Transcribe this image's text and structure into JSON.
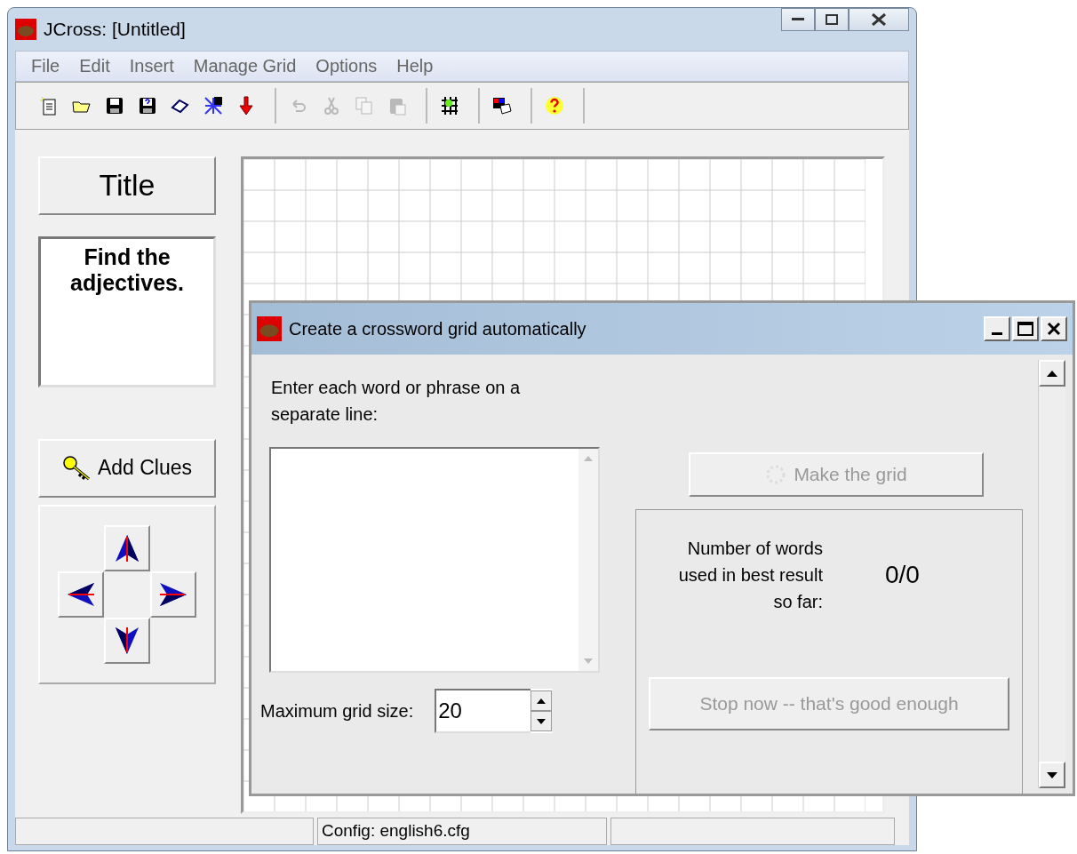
{
  "window": {
    "title": "JCross: [Untitled]"
  },
  "menu": [
    "File",
    "Edit",
    "Insert",
    "Manage Grid",
    "Options",
    "Help"
  ],
  "toolbar": [
    [
      {
        "disabled": false
      },
      {
        "disabled": false
      },
      {
        "disabled": false
      },
      {
        "disabled": false
      },
      {
        "disabled": false
      },
      {
        "disabled": false
      },
      {
        "disabled": false
      }
    ],
    [
      {
        "disabled": true
      },
      {
        "disabled": true
      },
      {
        "disabled": true
      },
      {
        "disabled": true
      }
    ],
    [
      {
        "disabled": false
      }
    ],
    [
      {
        "disabled": false
      }
    ],
    [
      {
        "disabled": false
      }
    ]
  ],
  "title_button": "Title",
  "instructions": "Find the adjectives.",
  "add_clues_button": "Add Clues",
  "status_bar": {
    "config": "Config: english6.cfg"
  },
  "dialog": {
    "title": "Create a crossword grid automatically",
    "prompt": "Enter each word or phrase on a separate line:",
    "size_label": "Maximum grid size:",
    "size_value": "20",
    "make_button": {
      "label": "Make the grid",
      "disabled": true
    },
    "result_label": "Number of words used in best result so far:",
    "result_value": "0/0",
    "stop_button": {
      "label": "Stop now -- that's good enough",
      "disabled": true
    }
  }
}
